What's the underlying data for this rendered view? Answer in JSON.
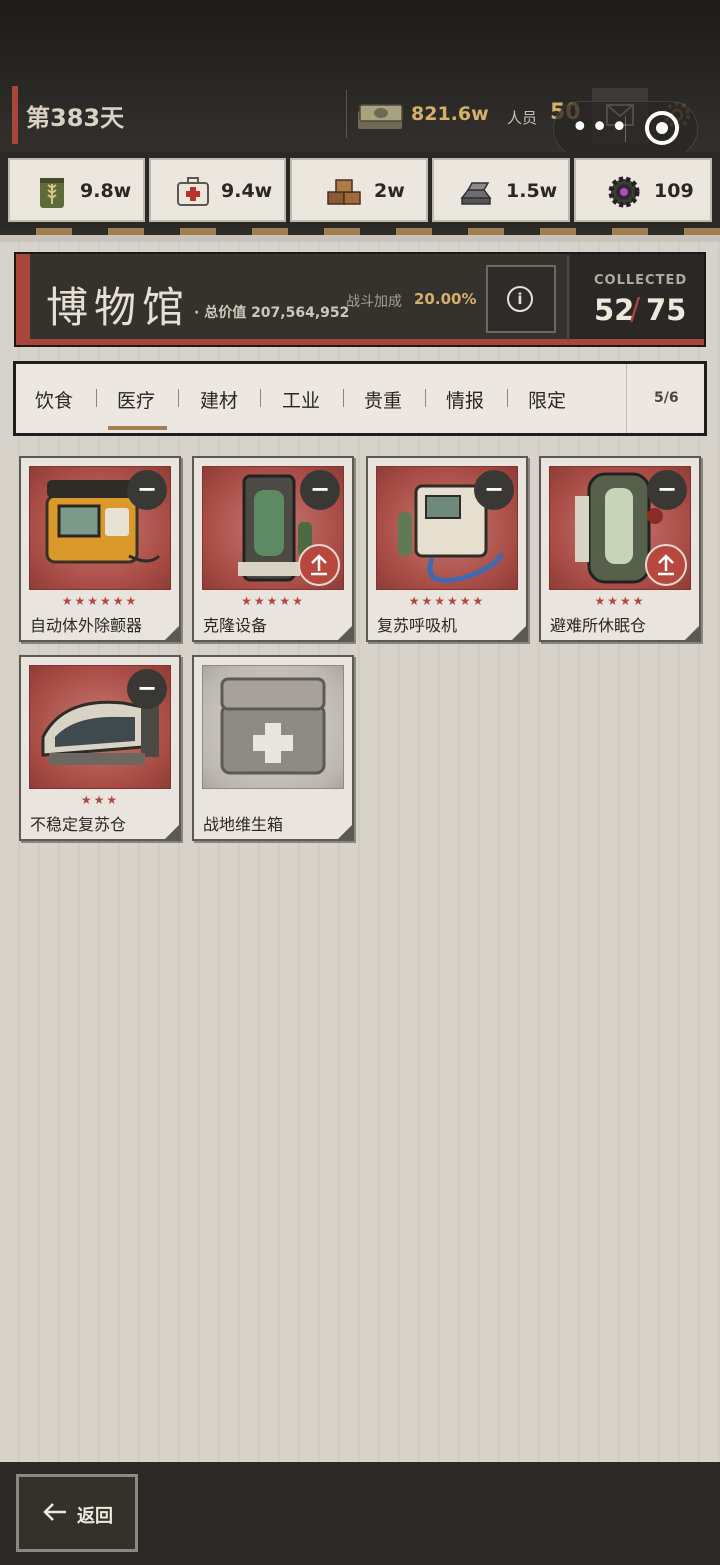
{
  "top_bar": {
    "day": "第383天",
    "money_value": "821.6w",
    "population_label": "人员",
    "population_value": "50"
  },
  "resources": [
    {
      "icon": "grain-icon",
      "value": "9.8w"
    },
    {
      "icon": "medkit-icon",
      "value": "9.4w"
    },
    {
      "icon": "bricks-icon",
      "value": "2w"
    },
    {
      "icon": "ingot-icon",
      "value": "1.5w"
    },
    {
      "icon": "gear-gem-icon",
      "value": "109"
    }
  ],
  "museum": {
    "title": "博物馆",
    "total_value": "· 总价值 207,564,952",
    "battle_bonus_label": "战斗加成",
    "battle_bonus_value": "20.00%",
    "collected_label": "COLLECTED",
    "collected_have": "52",
    "collected_slash": "/",
    "collected_total": "75"
  },
  "tabs": {
    "items": [
      "饮食",
      "医疗",
      "建材",
      "工业",
      "贵重",
      "情报",
      "限定"
    ],
    "active": "医疗",
    "page": "5/6"
  },
  "items": [
    {
      "name": "自动体外除颤器",
      "stars": "★★★★★★",
      "owned": true,
      "upgrade": false,
      "icon": "defibrillator-icon"
    },
    {
      "name": "克隆设备",
      "stars": "★★★★★",
      "owned": true,
      "upgrade": true,
      "icon": "cloning-device-icon"
    },
    {
      "name": "复苏呼吸机",
      "stars": "★★★★★★",
      "owned": true,
      "upgrade": false,
      "icon": "ventilator-icon"
    },
    {
      "name": "避难所休眠仓",
      "stars": "★★★★",
      "owned": true,
      "upgrade": true,
      "icon": "hibernation-pod-icon"
    },
    {
      "name": "不稳定复苏仓",
      "stars": "★★★",
      "owned": true,
      "upgrade": false,
      "icon": "revival-pod-icon"
    },
    {
      "name": "战地维生箱",
      "stars": "",
      "owned": false,
      "upgrade": false,
      "icon": "field-life-support-icon"
    }
  ],
  "bottom": {
    "back_label": "返回"
  },
  "colors": {
    "accent_red": "#a8463b",
    "gold": "#d5b06a",
    "dark": "#2a2825"
  }
}
